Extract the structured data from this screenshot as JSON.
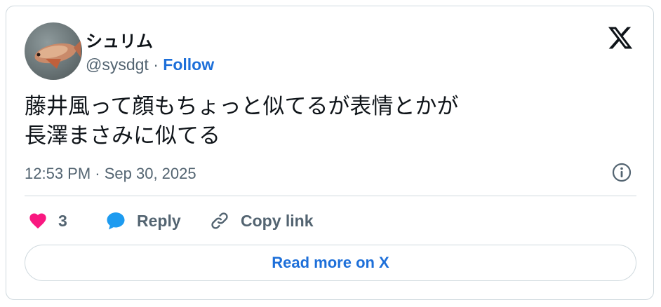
{
  "author": {
    "display_name": "シュリム",
    "handle": "@sysdgt",
    "separator": "·",
    "follow_label": "Follow"
  },
  "brand_icon": "x-logo-icon",
  "tweet": {
    "text": "藤井風って顔もちょっと似てるが表情とかが\n長澤まさみに似てる",
    "timestamp": "12:53 PM · Sep 30, 2025"
  },
  "actions": {
    "like_count": "3",
    "reply_label": "Reply",
    "copy_link_label": "Copy link"
  },
  "read_more_label": "Read more on X",
  "colors": {
    "like": "#f91880",
    "reply": "#1d9bf0",
    "link": "#1d6fd9",
    "secondary_text": "#536471",
    "border": "#cfd9de"
  }
}
